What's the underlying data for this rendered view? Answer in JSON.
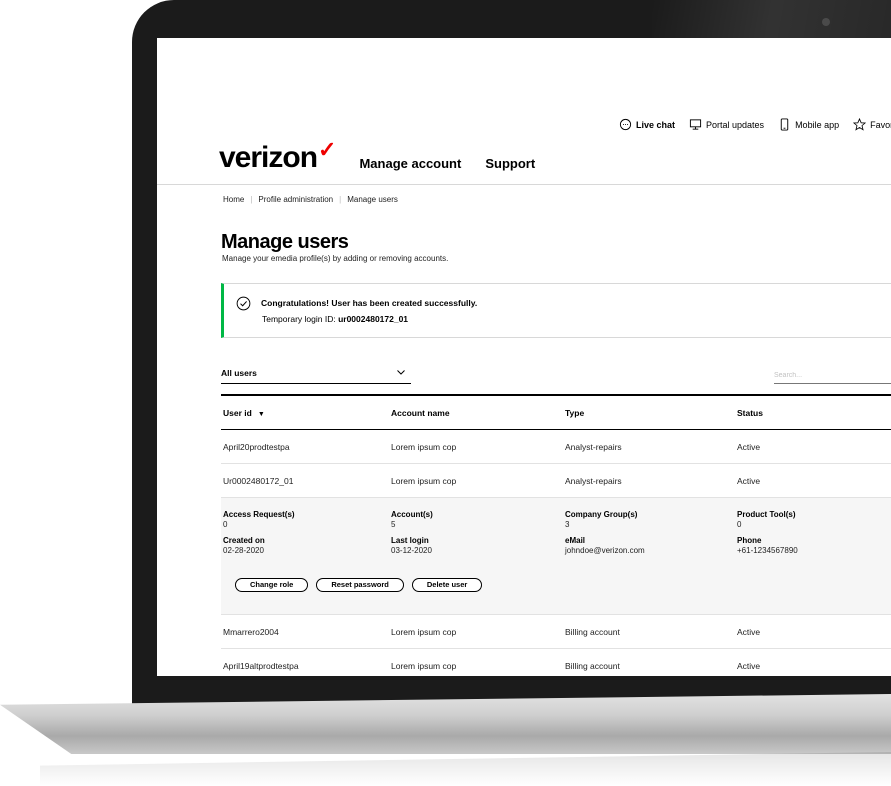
{
  "utility": {
    "live_chat": "Live chat",
    "portal_updates": "Portal updates",
    "mobile_app": "Mobile app",
    "favorites": "Favorite"
  },
  "brand": {
    "logo_text": "verizon",
    "logo_check": "✓",
    "accent_color": "#ee0000"
  },
  "nav": {
    "manage_account": "Manage account",
    "support": "Support"
  },
  "breadcrumb": [
    "Home",
    "Profile administration",
    "Manage users"
  ],
  "page": {
    "title": "Manage users",
    "subtitle": "Manage your emedia profile(s) by adding or removing accounts."
  },
  "alert": {
    "title": "Congratulations! User has been created successfully.",
    "detail_label": "Temporary login ID:",
    "detail_value": "ur0002480172_01",
    "accent_color": "#00b845"
  },
  "filter": {
    "selected": "All users"
  },
  "search": {
    "placeholder": "Search..."
  },
  "table": {
    "headers": [
      "User id",
      "Account name",
      "Type",
      "Status"
    ],
    "rows": [
      [
        "April20prodtestpa",
        "Lorem ipsum cop",
        "Analyst-repairs",
        "Active"
      ],
      [
        "Ur0002480172_01",
        "Lorem ipsum cop",
        "Analyst-repairs",
        "Active"
      ],
      [
        "Mmarrero2004",
        "Lorem ipsum cop",
        "Billing account",
        "Active"
      ],
      [
        "April19altprodtestpa",
        "Lorem ipsum cop",
        "Billing account",
        "Active"
      ]
    ],
    "expanded": {
      "line1": [
        {
          "label": "Access Request(s)",
          "value": "0"
        },
        {
          "label": "Account(s)",
          "value": "5"
        },
        {
          "label": "Company Group(s)",
          "value": "3"
        },
        {
          "label": "Product Tool(s)",
          "value": "0"
        }
      ],
      "line2": [
        {
          "label": "Created on",
          "value": "02-28-2020"
        },
        {
          "label": "Last login",
          "value": "03-12-2020"
        },
        {
          "label": "eMail",
          "value": "johndoe@verizon.com"
        },
        {
          "label": "Phone",
          "value": "+61-1234567890"
        }
      ],
      "buttons": {
        "change_role": "Change role",
        "reset_password": "Reset password",
        "delete_user": "Delete user"
      }
    }
  }
}
